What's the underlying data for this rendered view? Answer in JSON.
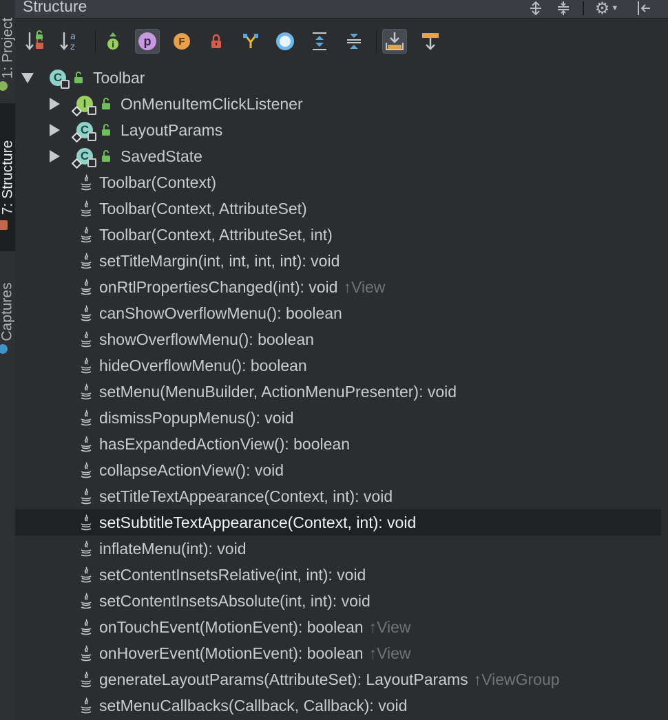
{
  "side_tabs": [
    {
      "label": "1: Project",
      "active": false
    },
    {
      "label": "7: Structure",
      "active": true
    },
    {
      "label": "Captures",
      "active": false
    }
  ],
  "panel": {
    "title": "Structure"
  },
  "toolbar": {
    "buttons": [
      {
        "name": "sort-by-visibility-button",
        "icon": "sort-visibility-icon"
      },
      {
        "name": "sort-alphabetically-button",
        "icon": "sort-alpha-icon",
        "glyph_a": "a",
        "glyph_z": "z"
      },
      {
        "name": "show-inherited-button",
        "icon": "inherited-icon"
      },
      {
        "name": "show-properties-button",
        "icon": "property-icon",
        "glyph": "p"
      },
      {
        "name": "show-fields-button",
        "icon": "field-icon",
        "glyph": "F"
      },
      {
        "name": "show-non-public-button",
        "icon": "lock-icon"
      },
      {
        "name": "show-lambdas-button",
        "icon": "fork-icon"
      },
      {
        "name": "show-anonymous-button",
        "icon": "circle-icon"
      },
      {
        "name": "expand-all-button",
        "icon": "expand-all-icon"
      },
      {
        "name": "collapse-all-button",
        "icon": "collapse-all-icon"
      },
      {
        "name": "autoscroll-to-source-button",
        "icon": "autoscroll-to-source-icon",
        "pressed": true
      },
      {
        "name": "autoscroll-from-source-button",
        "icon": "autoscroll-from-source-icon"
      }
    ]
  },
  "tree": {
    "root": {
      "label": "Toolbar",
      "icon": "class-icon",
      "icon_glyph": "C",
      "expanded": true
    },
    "nested": [
      {
        "label": "OnMenuItemClickListener",
        "icon": "interface-icon",
        "icon_glyph": "I"
      },
      {
        "label": "LayoutParams",
        "icon": "class-icon",
        "icon_glyph": "C"
      },
      {
        "label": "SavedState",
        "icon": "class-icon",
        "icon_glyph": "C"
      }
    ],
    "methods": [
      {
        "label": "Toolbar(Context)",
        "inherited": ""
      },
      {
        "label": "Toolbar(Context, AttributeSet)",
        "inherited": ""
      },
      {
        "label": "Toolbar(Context, AttributeSet, int)",
        "inherited": ""
      },
      {
        "label": "setTitleMargin(int, int, int, int): void",
        "inherited": ""
      },
      {
        "label": "onRtlPropertiesChanged(int): void",
        "inherited": "↑View"
      },
      {
        "label": "canShowOverflowMenu(): boolean",
        "inherited": ""
      },
      {
        "label": "showOverflowMenu(): boolean",
        "inherited": ""
      },
      {
        "label": "hideOverflowMenu(): boolean",
        "inherited": ""
      },
      {
        "label": "setMenu(MenuBuilder, ActionMenuPresenter): void",
        "inherited": ""
      },
      {
        "label": "dismissPopupMenus(): void",
        "inherited": ""
      },
      {
        "label": "hasExpandedActionView(): boolean",
        "inherited": ""
      },
      {
        "label": "collapseActionView(): void",
        "inherited": ""
      },
      {
        "label": "setTitleTextAppearance(Context, int): void",
        "inherited": ""
      },
      {
        "label": "setSubtitleTextAppearance(Context, int): void",
        "inherited": "",
        "selected": true
      },
      {
        "label": "inflateMenu(int): void",
        "inherited": ""
      },
      {
        "label": "setContentInsetsRelative(int, int): void",
        "inherited": ""
      },
      {
        "label": "setContentInsetsAbsolute(int, int): void",
        "inherited": ""
      },
      {
        "label": "onTouchEvent(MotionEvent): boolean",
        "inherited": "↑View"
      },
      {
        "label": "onHoverEvent(MotionEvent): boolean",
        "inherited": "↑View"
      },
      {
        "label": "generateLayoutParams(AttributeSet): LayoutParams",
        "inherited": "↑ViewGroup"
      },
      {
        "label": "setMenuCallbacks(Callback, Callback): void",
        "inherited": ""
      }
    ]
  },
  "colors": {
    "background": "#2b2d30",
    "text": "#c8ccd0",
    "inherited_text": "#6f7479",
    "class_icon": "#8fd3c8",
    "interface_icon": "#9ccf62",
    "public_lock": "#6fbf5a"
  }
}
